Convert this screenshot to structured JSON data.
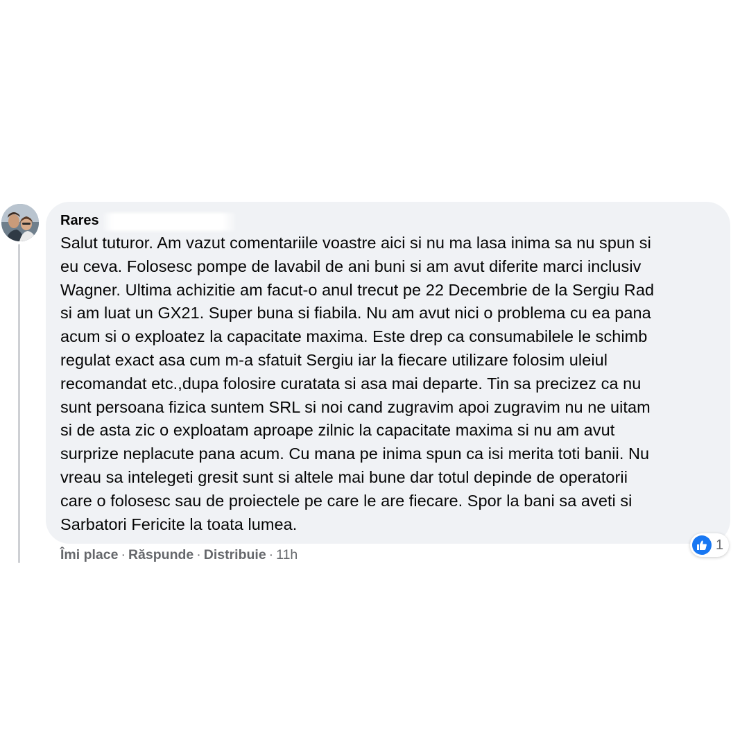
{
  "comment": {
    "author": "Rares",
    "lines": [
      "Salut tuturor. Am vazut comentariile voastre aici si nu ma lasa inima sa nu spun si",
      "eu ceva. Folosesc pompe de lavabil de ani buni si am avut diferite marci inclusiv",
      "Wagner. Ultima achizitie am facut-o anul trecut pe 22 Decembrie de la Sergiu Rad",
      "si am luat un GX21. Super buna si fiabila. Nu am avut nici o problema cu ea pana",
      "acum si o exploatez la capacitate maxima. Este drep ca consumabilele le schimb",
      "regulat exact asa cum m-a sfatuit Sergiu iar la fiecare utilizare folosim uleiul",
      "recomandat etc.,dupa folosire curatata si asa mai departe. Tin sa precizez ca nu",
      "sunt persoana fizica suntem SRL si noi cand zugravim apoi zugravim nu ne uitam",
      "si de asta zic o exploatam aproape zilnic la capacitate maxima si nu am avut",
      "surprize neplacute pana acum. Cu mana pe inima spun ca isi merita toti banii. Nu",
      "vreau sa intelegeti gresit sunt si altele mai bune dar totul depinde de operatorii",
      "care o folosesc sau de proiectele pe care le are fiecare. Spor la bani sa aveti si",
      "Sarbatori Fericite la toata lumea."
    ],
    "reactions": {
      "icon": "like-icon",
      "count": "1",
      "color": "#1877f2"
    },
    "actions": {
      "like": "Îmi place",
      "reply": "Răspunde",
      "share": "Distribuie",
      "separator": "·",
      "time": "11h"
    }
  },
  "colors": {
    "bubble": "#f0f2f5",
    "text": "#050505",
    "secondary_text": "#65676b",
    "thread_line": "#ced0d4"
  }
}
